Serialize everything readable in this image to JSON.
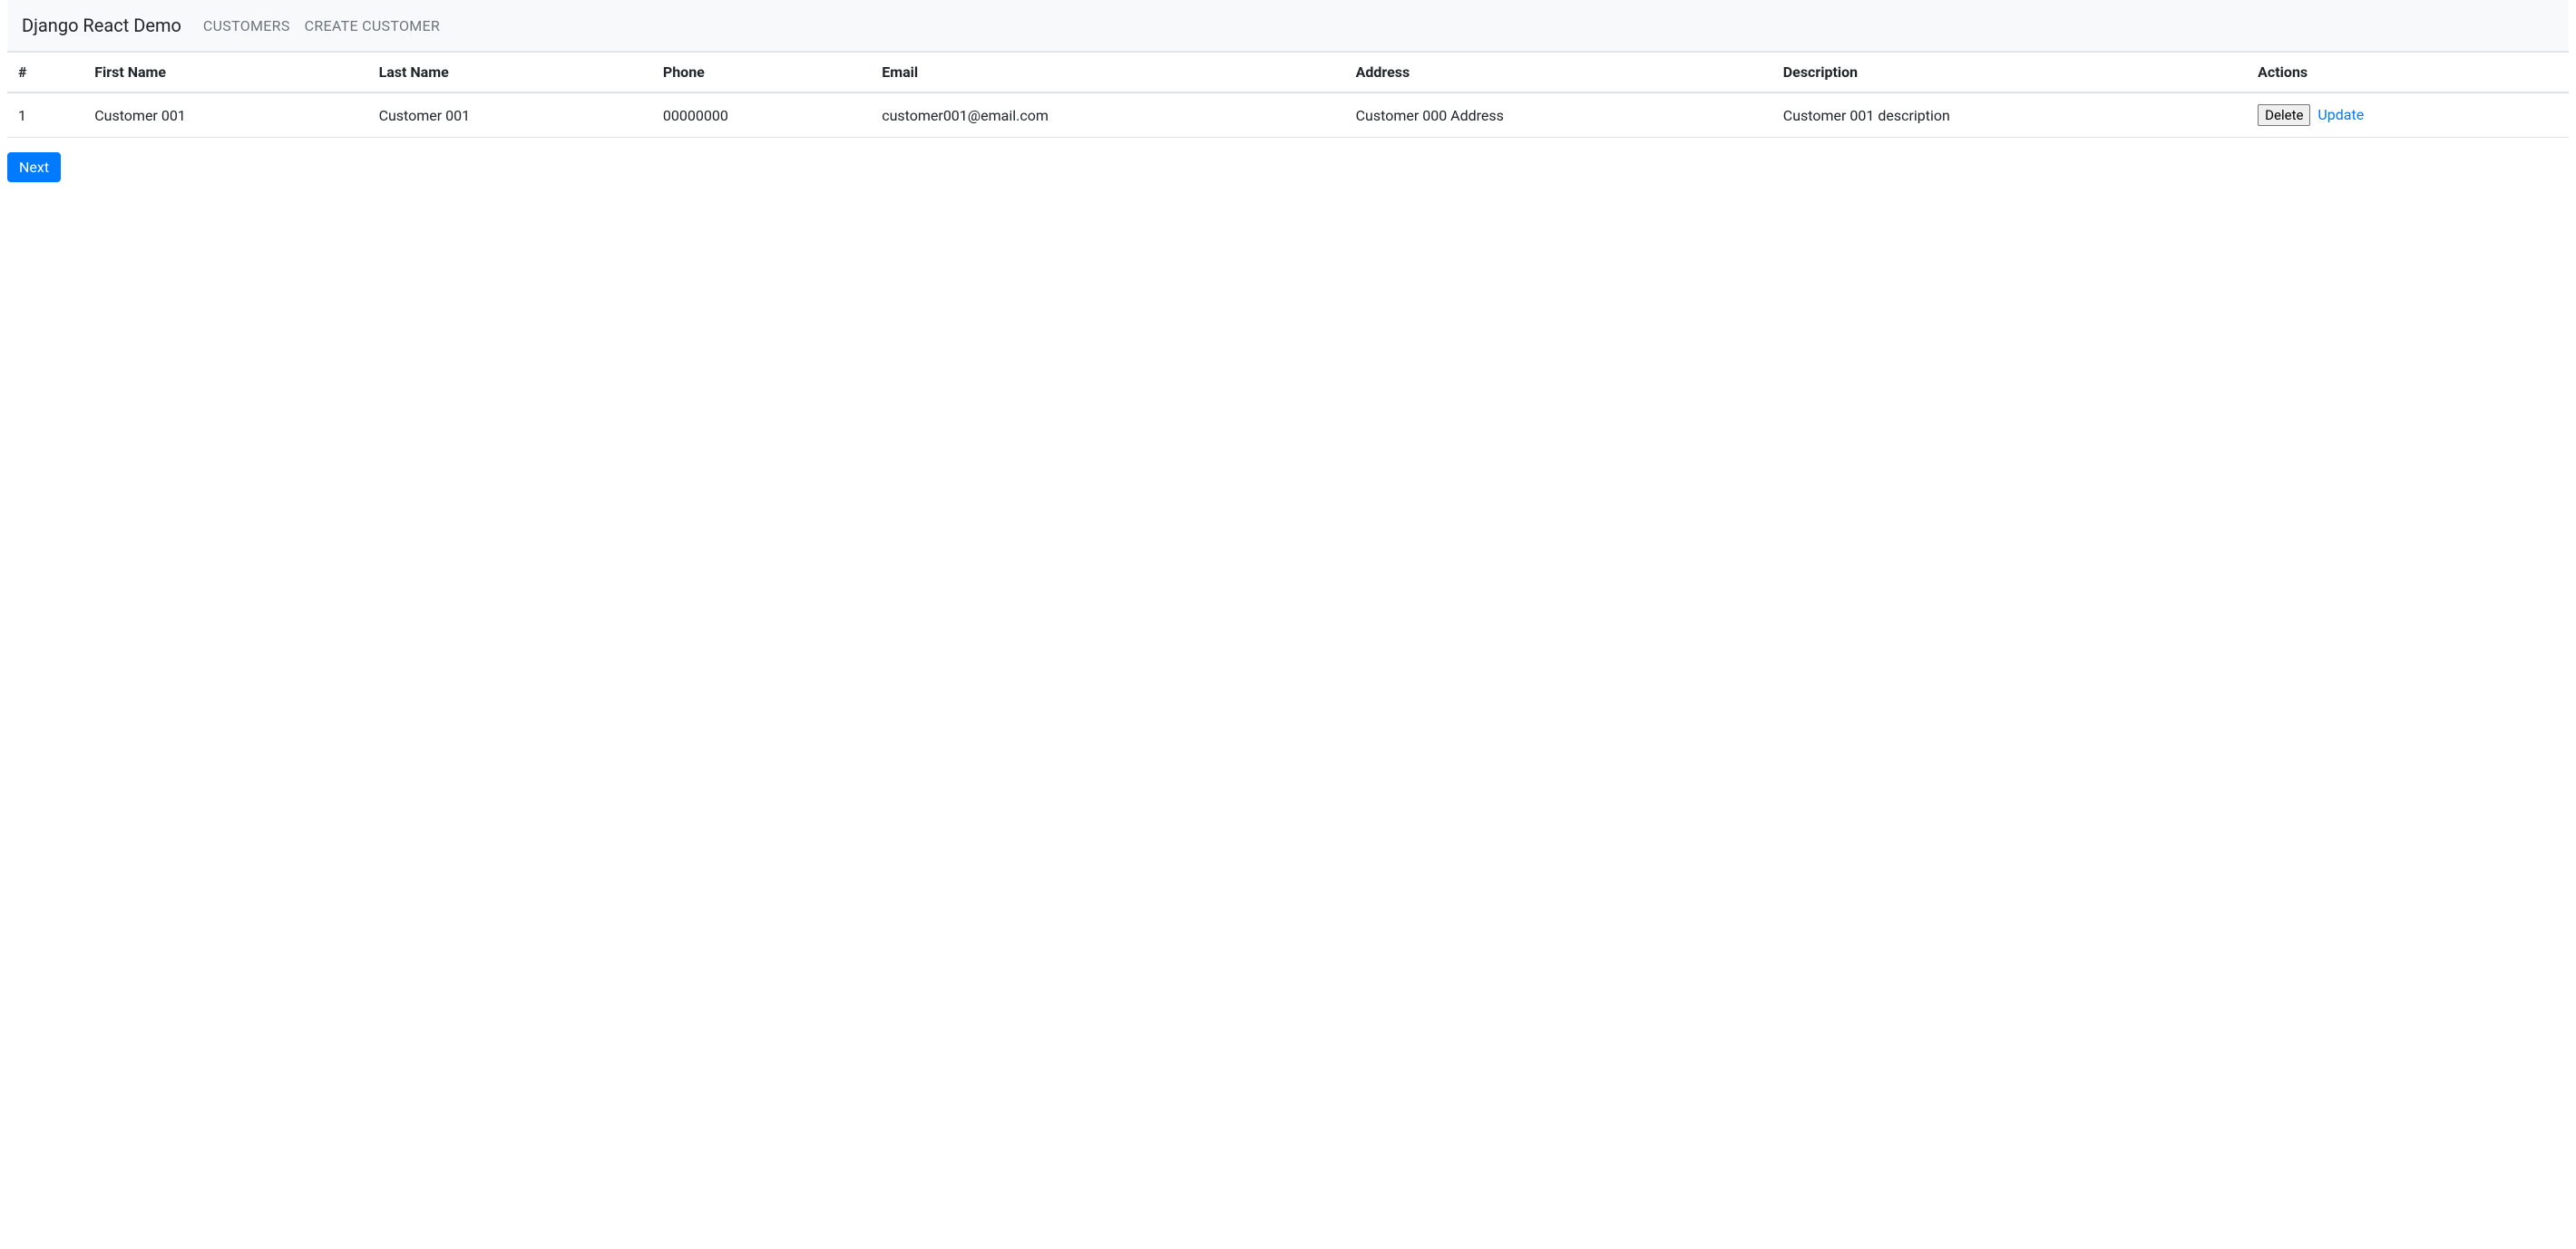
{
  "navbar": {
    "brand": "Django React Demo",
    "links": [
      {
        "label": "CUSTOMERS"
      },
      {
        "label": "CREATE CUSTOMER"
      }
    ]
  },
  "table": {
    "headers": {
      "num": "#",
      "first_name": "First Name",
      "last_name": "Last Name",
      "phone": "Phone",
      "email": "Email",
      "address": "Address",
      "description": "Description",
      "actions": "Actions"
    },
    "rows": [
      {
        "num": "1",
        "first_name": "Customer 001",
        "last_name": "Customer 001",
        "phone": "00000000",
        "email": "customer001@email.com",
        "address": "Customer 000 Address",
        "description": "Customer 001 description",
        "delete_label": "Delete",
        "update_label": "Update"
      }
    ]
  },
  "pagination": {
    "next_label": "Next"
  }
}
